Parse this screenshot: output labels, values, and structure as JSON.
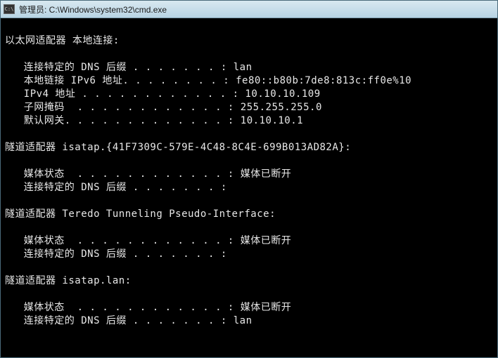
{
  "titlebar": {
    "icon_label": "C:\\",
    "text": "管理员: C:\\Windows\\system32\\cmd.exe"
  },
  "console": {
    "adapter1": {
      "header": "以太网适配器 本地连接:",
      "dns_suffix_label": "   连接特定的 DNS 后缀 . . . . . . . :",
      "dns_suffix_value": " lan",
      "ipv6_label": "   本地链接 IPv6 地址. . . . . . . . :",
      "ipv6_value": " fe80::b80b:7de8:813c:ff0e%10",
      "ipv4_label": "   IPv4 地址 . . . . . . . . . . . . :",
      "ipv4_value": " 10.10.10.109",
      "subnet_label": "   子网掩码  . . . . . . . . . . . . :",
      "subnet_value": " 255.255.255.0",
      "gateway_label": "   默认网关. . . . . . . . . . . . . :",
      "gateway_value": " 10.10.10.1"
    },
    "adapter2": {
      "header": "隧道适配器 isatap.{41F7309C-579E-4C48-8C4E-699B013AD82A}:",
      "media_label": "   媒体状态  . . . . . . . . . . . . :",
      "media_value": " 媒体已断开",
      "dns_suffix_label": "   连接特定的 DNS 后缀 . . . . . . . :",
      "dns_suffix_value": ""
    },
    "adapter3": {
      "header": "隧道适配器 Teredo Tunneling Pseudo-Interface:",
      "media_label": "   媒体状态  . . . . . . . . . . . . :",
      "media_value": " 媒体已断开",
      "dns_suffix_label": "   连接特定的 DNS 后缀 . . . . . . . :",
      "dns_suffix_value": ""
    },
    "adapter4": {
      "header": "隧道适配器 isatap.lan:",
      "media_label": "   媒体状态  . . . . . . . . . . . . :",
      "media_value": " 媒体已断开",
      "dns_suffix_label": "   连接特定的 DNS 后缀 . . . . . . . :",
      "dns_suffix_value": " lan"
    }
  }
}
